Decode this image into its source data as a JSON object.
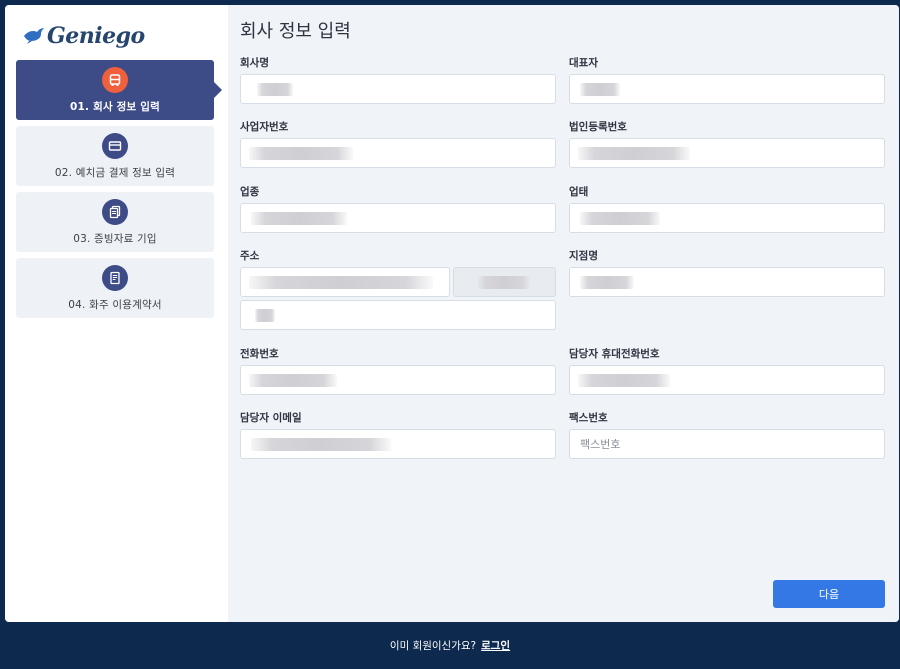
{
  "app": {
    "logo_text": "Geniego"
  },
  "sidebar": {
    "steps": [
      {
        "label": "01. 회사 정보 입력",
        "icon": "bus-icon",
        "active": true
      },
      {
        "label": "02. 예치금 결제 정보 입력",
        "icon": "card-icon",
        "active": false
      },
      {
        "label": "03. 증빙자료 기입",
        "icon": "documents-icon",
        "active": false
      },
      {
        "label": "04. 화주 이용계약서",
        "icon": "contract-icon",
        "active": false
      }
    ]
  },
  "form": {
    "title": "회사 정보 입력",
    "fields": {
      "company_name": {
        "label": "회사명",
        "value": ""
      },
      "representative": {
        "label": "대표자",
        "value": ""
      },
      "business_number": {
        "label": "사업자번호",
        "value": ""
      },
      "corp_reg_number": {
        "label": "법인등록번호",
        "value": ""
      },
      "business_type": {
        "label": "업종",
        "value": ""
      },
      "business_item": {
        "label": "업태",
        "value": ""
      },
      "address": {
        "label": "주소",
        "value": "",
        "postal": "",
        "detail": ""
      },
      "branch_name": {
        "label": "지점명",
        "value": ""
      },
      "phone": {
        "label": "전화번호",
        "value": ""
      },
      "manager_mobile": {
        "label": "담당자 휴대전화번호",
        "value": ""
      },
      "manager_email": {
        "label": "담당자 이메일",
        "value": ""
      },
      "fax": {
        "label": "팩스번호",
        "value": "",
        "placeholder": "팩스번호"
      }
    },
    "next_label": "다음"
  },
  "footer": {
    "prompt": "이미 회원이신가요?",
    "login_label": "로그인"
  },
  "colors": {
    "accent": "#3478e6",
    "active_step": "#3d4b87",
    "active_icon": "#f0603c",
    "footer_bg": "#0d2a4e"
  }
}
